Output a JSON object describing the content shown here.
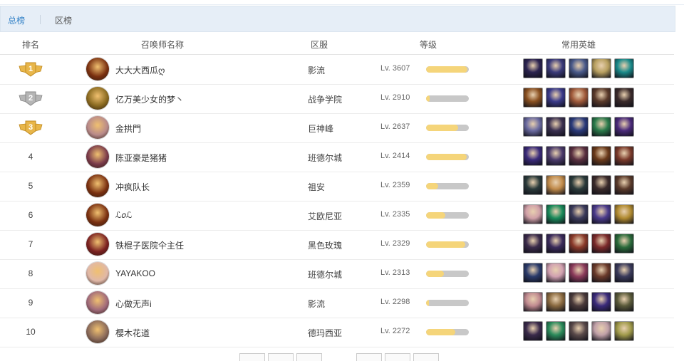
{
  "tabs": [
    {
      "label": "总榜",
      "active": true
    },
    {
      "label": "区榜",
      "active": false
    }
  ],
  "headers": {
    "rank": "排名",
    "name": "召唤师名称",
    "region": "区服",
    "level": "等级",
    "heroes": "常用英雄"
  },
  "colors": {
    "accent": "#2f7fc6",
    "tab_bar_bg": "#e6eef7",
    "bar_fill": "#f5d57a",
    "bar_track": "#c8c8c8",
    "gold_medal": "#e8b64a",
    "silver_medal": "#b5b5b5"
  },
  "rows": [
    {
      "rank": "1",
      "medal": "gold",
      "name": "大大大西瓜ღ",
      "region": "影流",
      "level": "Lv. 3607",
      "progress": 0.97,
      "avatar_color": "#7a3010",
      "heroes": [
        "#2b2350",
        "#3a3a7a",
        "#4a5a8a",
        "#b8a060",
        "#1a8a8a"
      ]
    },
    {
      "rank": "2",
      "medal": "silver",
      "name": "亿万美少女的梦丶",
      "region": "战争学院",
      "level": "Lv. 2910",
      "progress": 0.08,
      "avatar_color": "#8a6a20",
      "heroes": [
        "#8a5020",
        "#3a3a8a",
        "#a05a3a",
        "#5a3a2a",
        "#3a2a2a"
      ]
    },
    {
      "rank": "3",
      "medal": "gold",
      "name": "金拱門",
      "region": "巨神峰",
      "level": "Lv. 2637",
      "progress": 0.75,
      "avatar_color": "#b88a8a",
      "heroes": [
        "#6a6aa0",
        "#3a3050",
        "#2a3a7a",
        "#2a7a4a",
        "#4a2a7a"
      ]
    },
    {
      "rank": "4",
      "name": "陈亚豪是猪猪",
      "region": "班德尔城",
      "level": "Lv. 2414",
      "progress": 0.95,
      "avatar_color": "#7a3a4a",
      "heroes": [
        "#3a2a7a",
        "#4a3a6a",
        "#5a3040",
        "#6a3a1a",
        "#7a3a2a"
      ]
    },
    {
      "rank": "5",
      "name": "冲疯队长",
      "region": "祖安",
      "level": "Lv. 2359",
      "progress": 0.28,
      "avatar_color": "#7a3010",
      "heroes": [
        "#2a3a3a",
        "#c08a4a",
        "#2a3a3a",
        "#3a2a2a",
        "#5a3a2a"
      ]
    },
    {
      "rank": "6",
      "name": "ℒ𝑜ℒ",
      "region": "艾欧尼亚",
      "level": "Lv. 2335",
      "progress": 0.45,
      "avatar_color": "#7a3010",
      "heroes": [
        "#d0a0a8",
        "#1a8a5a",
        "#3a3a5a",
        "#4a3a8a",
        "#b08a30"
      ]
    },
    {
      "rank": "7",
      "name": "铁棍子医院仐主任",
      "region": "黑色玫瑰",
      "level": "Lv. 2329",
      "progress": 0.92,
      "avatar_color": "#7a2020",
      "heroes": [
        "#3a2a4a",
        "#3a2a5a",
        "#8a3a2a",
        "#7a2a2a",
        "#2a6a3a"
      ]
    },
    {
      "rank": "8",
      "name": "YAYAKOO",
      "region": "班德尔城",
      "level": "Lv. 2313",
      "progress": 0.42,
      "avatar_color": "#e0b8a8",
      "heroes": [
        "#2a3a6a",
        "#d0a0b0",
        "#8a3a5a",
        "#6a3a2a",
        "#3a3a5a"
      ]
    },
    {
      "rank": "9",
      "name": "心做无声i",
      "region": "影流",
      "level": "Lv. 2298",
      "progress": 0.06,
      "avatar_color": "#a06a7a",
      "heroes": [
        "#c08a90",
        "#8a6a40",
        "#4a3a3a",
        "#3a2a7a",
        "#5a5a3a"
      ]
    },
    {
      "rank": "10",
      "name": "樱木花道",
      "region": "德玛西亚",
      "level": "Lv. 2272",
      "progress": 0.68,
      "avatar_color": "#8a6a5a",
      "heroes": [
        "#3a2a4a",
        "#2a8a5a",
        "#5a4a4a",
        "#c0a0a8",
        "#a09a4a"
      ]
    }
  ]
}
